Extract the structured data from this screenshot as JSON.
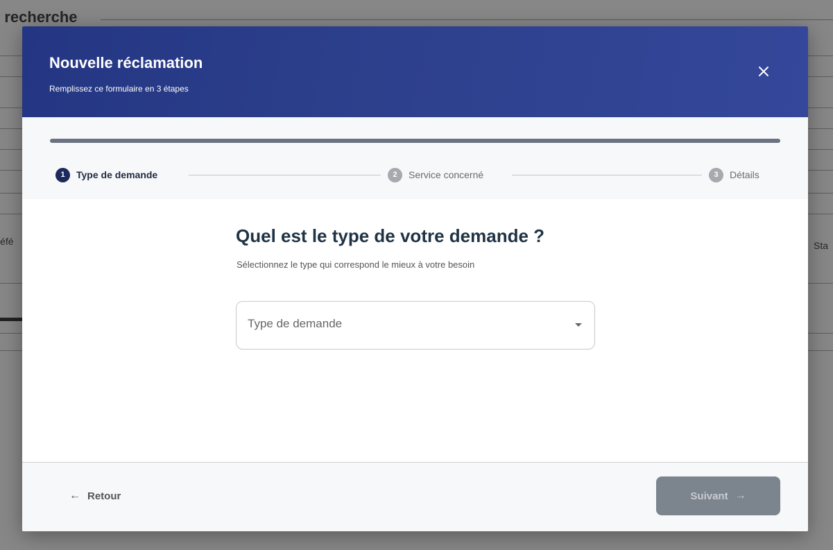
{
  "background": {
    "fieldset_title": "e recherche",
    "column_left": "Réfé",
    "column_right": "Sta"
  },
  "modal": {
    "title": "Nouvelle réclamation",
    "subtitle": "Remplissez ce formulaire en 3 étapes",
    "close_icon": "close-icon",
    "steps": [
      {
        "number": "1",
        "label": "Type de demande",
        "state": "active"
      },
      {
        "number": "2",
        "label": "Service concerné",
        "state": "inactive"
      },
      {
        "number": "3",
        "label": "Détails",
        "state": "inactive"
      }
    ],
    "question": "Quel est le type de votre demande ?",
    "question_hint": "Sélectionnez le type qui correspond le mieux à votre besoin",
    "select": {
      "placeholder": "Type de demande",
      "icon": "caret-down-icon"
    },
    "footer": {
      "back_label": "Retour",
      "back_icon": "arrow-left-icon",
      "next_label": "Suivant",
      "next_icon": "arrow-right-icon",
      "next_disabled": true
    },
    "colors": {
      "header_gradient_start": "#243683",
      "header_gradient_end": "#34479a",
      "active_step": "#1e2a5e",
      "inactive_step": "#a7a9ae",
      "next_button": "#7c848e"
    }
  }
}
